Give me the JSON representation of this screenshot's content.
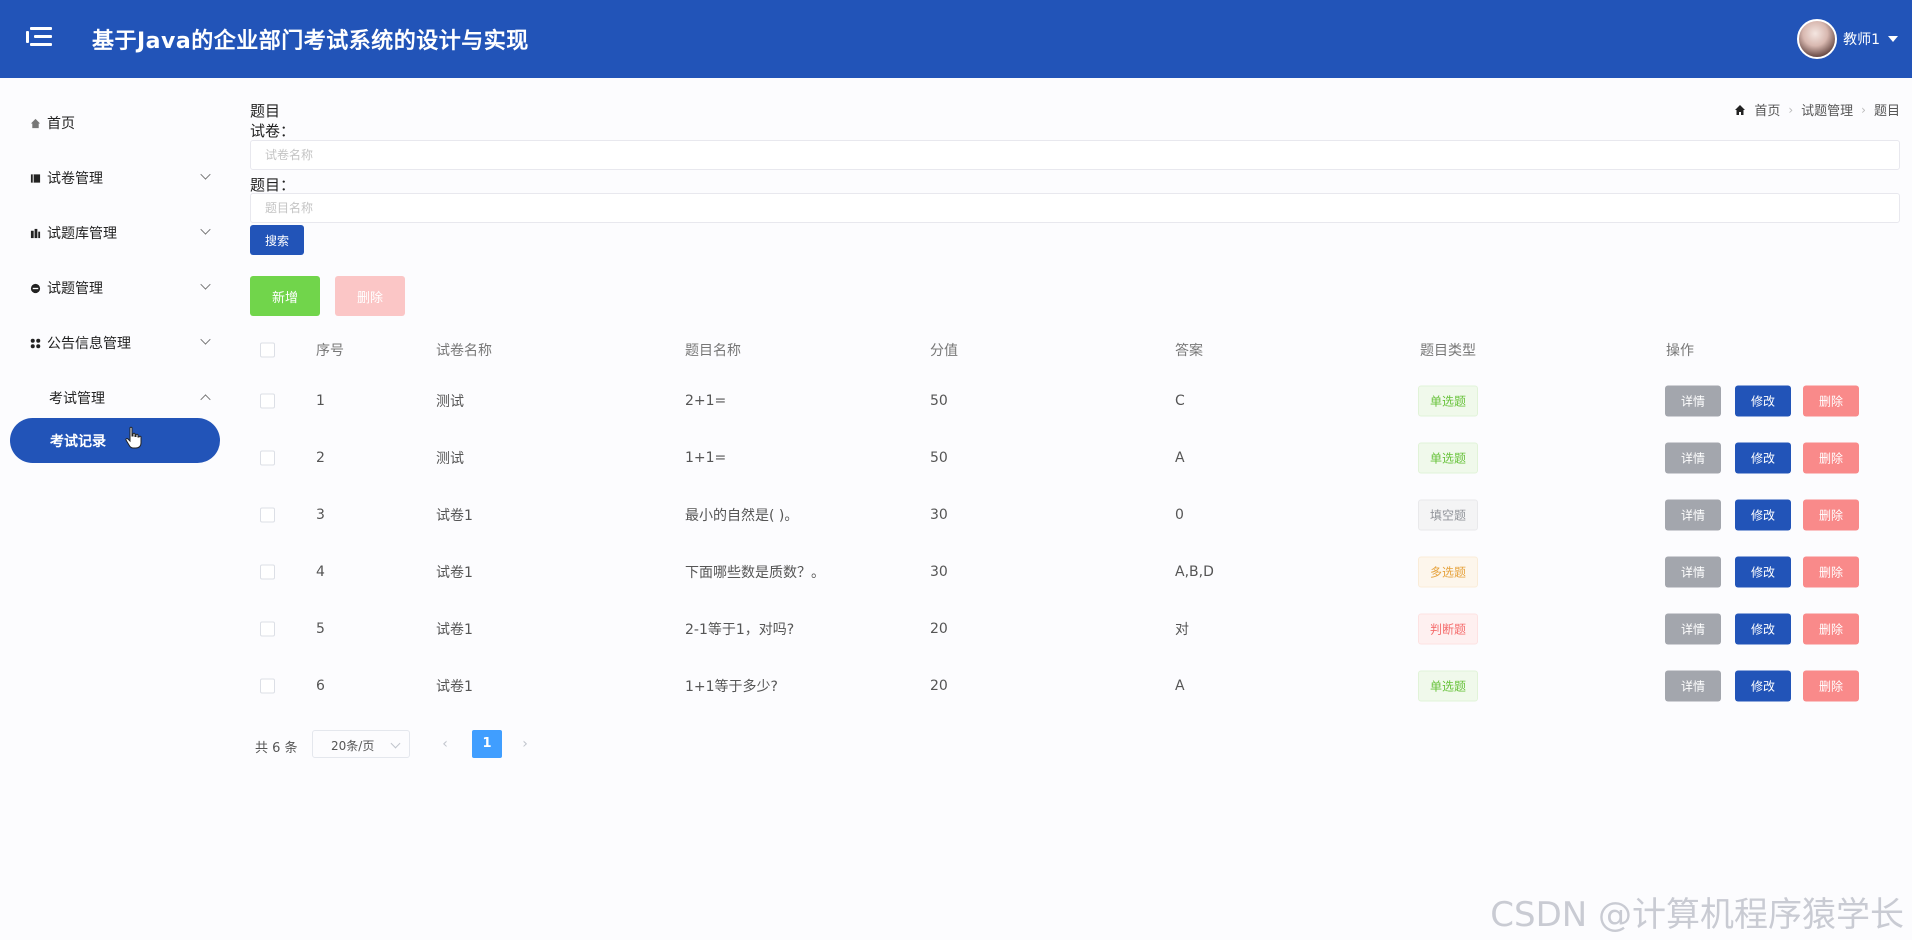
{
  "header": {
    "app_title": "基于Java的企业部门考试系统的设计与实现",
    "user_name": "教师1"
  },
  "sidebar": {
    "items": [
      {
        "label": "首页",
        "icon": "home-icon"
      },
      {
        "label": "试卷管理",
        "icon": "book-icon"
      },
      {
        "label": "试题库管理",
        "icon": "library-icon"
      },
      {
        "label": "试题管理",
        "icon": "circle-icon"
      },
      {
        "label": "公告信息管理",
        "icon": "grid-icon"
      },
      {
        "label": "考试管理",
        "icon": ""
      }
    ],
    "active_item": "考试记录"
  },
  "page": {
    "title": "题目",
    "breadcrumb": [
      "首页",
      "试题管理",
      "题目"
    ]
  },
  "search": {
    "paper_label": "试卷：",
    "paper_placeholder": "试卷名称",
    "question_label": "题目：",
    "question_placeholder": "题目名称",
    "search_button": "搜索"
  },
  "actions": {
    "add_button": "新增",
    "batch_delete_button": "删除"
  },
  "table": {
    "headers": [
      "序号",
      "试卷名称",
      "题目名称",
      "分值",
      "答案",
      "题目类型",
      "操作"
    ],
    "rows": [
      {
        "no": "1",
        "paper": "测试",
        "question": "2+1=",
        "score": "50",
        "answer": "C",
        "type": "单选题",
        "type_color": "green"
      },
      {
        "no": "2",
        "paper": "测试",
        "question": "1+1=",
        "score": "50",
        "answer": "A",
        "type": "单选题",
        "type_color": "green"
      },
      {
        "no": "3",
        "paper": "试卷1",
        "question": "最小的自然是( )。",
        "score": "30",
        "answer": "0",
        "type": "填空题",
        "type_color": "gray"
      },
      {
        "no": "4",
        "paper": "试卷1",
        "question": "下面哪些数是质数？。",
        "score": "30",
        "answer": "A,B,D",
        "type": "多选题",
        "type_color": "yellow"
      },
      {
        "no": "5",
        "paper": "试卷1",
        "question": "2-1等于1，对吗?",
        "score": "20",
        "answer": "对",
        "type": "判断题",
        "type_color": "red"
      },
      {
        "no": "6",
        "paper": "试卷1",
        "question": "1+1等于多少?",
        "score": "20",
        "answer": "A",
        "type": "单选题",
        "type_color": "green"
      }
    ],
    "row_actions": {
      "detail": "详情",
      "edit": "修改",
      "delete": "删除"
    }
  },
  "pagination": {
    "total_text": "共 6 条",
    "page_size": "20条/页",
    "current_page": "1"
  },
  "colors": {
    "primary": "#2254b8",
    "add": "#71d54b",
    "danger": "#f98a8a",
    "info": "#a3a6ad"
  },
  "watermark": "CSDN @计算机程序猿学长"
}
